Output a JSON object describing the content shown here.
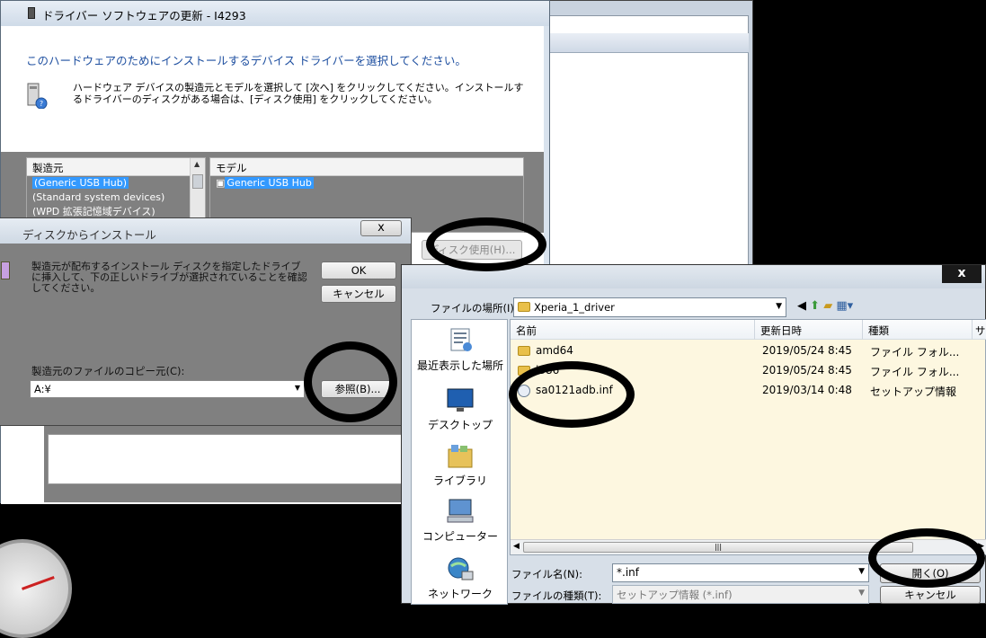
{
  "wizard": {
    "title": "ドライバー ソフトウェアの更新 - I4293",
    "heading": "このハードウェアのためにインストールするデバイス ドライバーを選択してください。",
    "description": "ハードウェア デバイスの製造元とモデルを選択して [次へ] をクリックしてください。インストールするドライバーのディスクがある場合は、[ディスク使用] をクリックしてください。",
    "manufacturer_header": "製造元",
    "manufacturers": [
      "(Generic USB Hub)",
      "(Standard system devices)",
      "(WPD 拡張記憶域デバイス)"
    ],
    "model_header": "モデル",
    "models": [
      "Generic USB Hub"
    ],
    "have_disk_button": "ディスク使用(H)..."
  },
  "disk_dialog": {
    "title": "ディスクからインストール",
    "close": "x",
    "message": "製造元が配布するインストール ディスクを指定したドライブに挿入して、下の正しいドライブが選択されていることを確認してください。",
    "ok_button": "OK",
    "cancel_button": "キャンセル",
    "copy_from_label": "製造元のファイルのコピー元(C):",
    "copy_from_value": "A:¥",
    "browse_button": "参照(B)..."
  },
  "file_dialog": {
    "close": "x",
    "look_in_label": "ファイルの場所(I):",
    "look_in_value": "Xperia_1_driver",
    "columns": [
      "名前",
      "更新日時",
      "種類",
      "サ"
    ],
    "files": [
      {
        "name": "amd64",
        "date": "2019/05/24 8:45",
        "type": "ファイル フォル...",
        "icon": "folder-icon"
      },
      {
        "name": "i386",
        "date": "2019/05/24 8:45",
        "type": "ファイル フォル...",
        "icon": "folder-icon"
      },
      {
        "name": "sa0121adb.inf",
        "date": "2019/03/14 0:48",
        "type": "セットアップ情報",
        "icon": "setup-file-icon"
      }
    ],
    "places": [
      "最近表示した場所",
      "デスクトップ",
      "ライブラリ",
      "コンピューター",
      "ネットワーク"
    ],
    "filename_label": "ファイル名(N):",
    "filename_value": "*.inf",
    "filetype_label": "ファイルの種類(T):",
    "filetype_value": "セットアップ情報 (*.inf)",
    "open_button": "開く(O)",
    "cancel_button": "キャンセル"
  },
  "colors": {
    "heading": "#1e4fa0",
    "selection": "#3399ff",
    "list_bg": "#fdf7e0"
  }
}
